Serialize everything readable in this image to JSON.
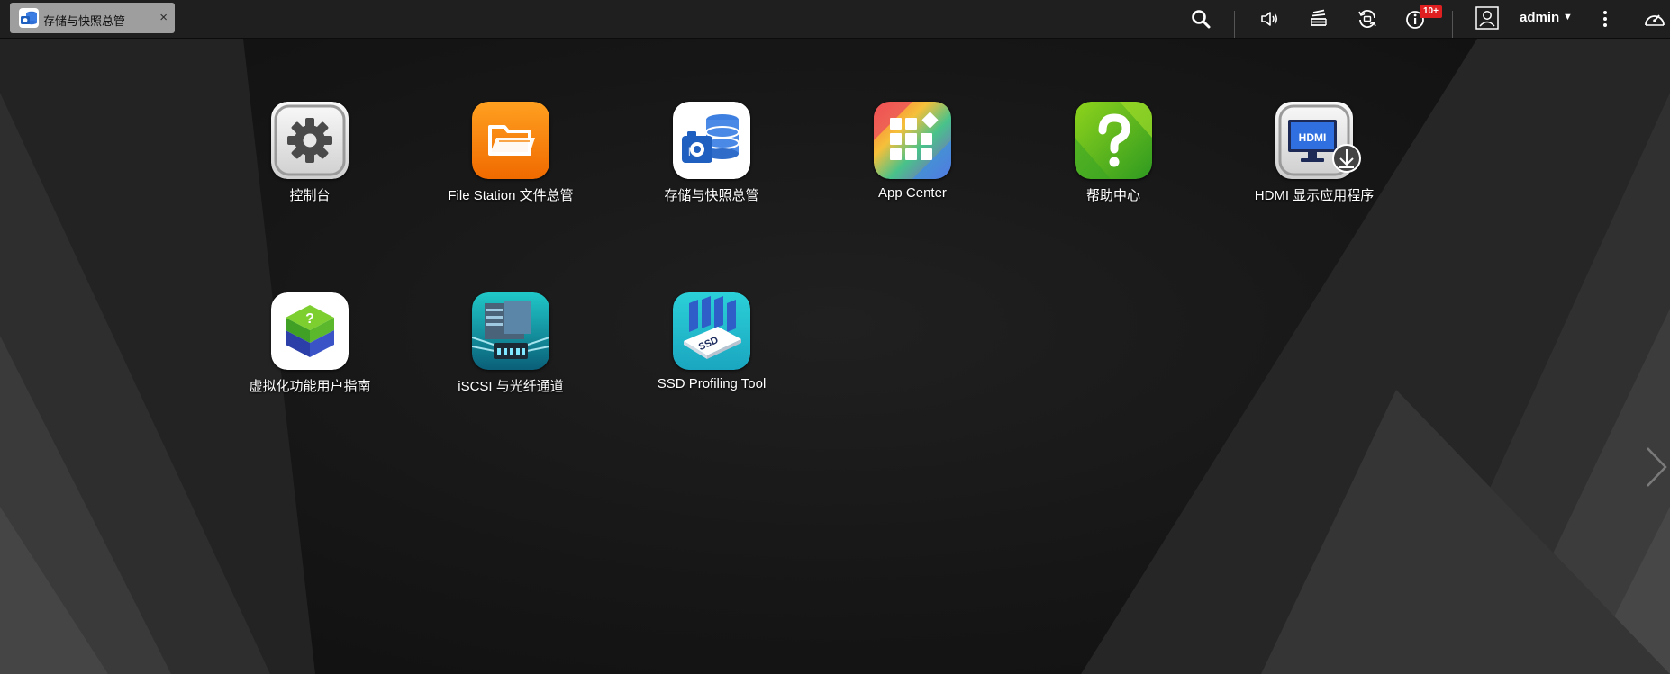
{
  "tab": {
    "label": "存储与快照总管",
    "close": "×",
    "icon": "storage-snapshot-icon"
  },
  "toolbar": {
    "icons": [
      "search-icon",
      "volume-icon",
      "background-tasks-icon",
      "sync-icon",
      "notification-icon",
      "user-icon",
      "more-icon",
      "dashboard-icon"
    ],
    "notification_badge": "10+",
    "user": "admin",
    "user_caret": "▼"
  },
  "apps": [
    {
      "label": "控制台",
      "icon": "gear-icon"
    },
    {
      "label": "File Station 文件总管",
      "icon": "folder-icon"
    },
    {
      "label": "存储与快照总管",
      "icon": "storage-snapshot-icon"
    },
    {
      "label": "App Center",
      "icon": "app-grid-icon"
    },
    {
      "label": "帮助中心",
      "icon": "help-icon"
    },
    {
      "label": "HDMI 显示应用程序",
      "icon": "hdmi-display-icon"
    },
    {
      "label": "虚拟化功能用户指南",
      "icon": "virtualization-guide-icon"
    },
    {
      "label": "iSCSI 与光纤通道",
      "icon": "iscsi-server-icon"
    },
    {
      "label": "SSD Profiling Tool",
      "icon": "ssd-icon"
    }
  ],
  "colors": {
    "topbar": "#1f1f1f",
    "tab": "#9e9e9e",
    "badge": "#e02020",
    "folder_orange": "#f57c00",
    "help_green": "#4caf1a"
  }
}
